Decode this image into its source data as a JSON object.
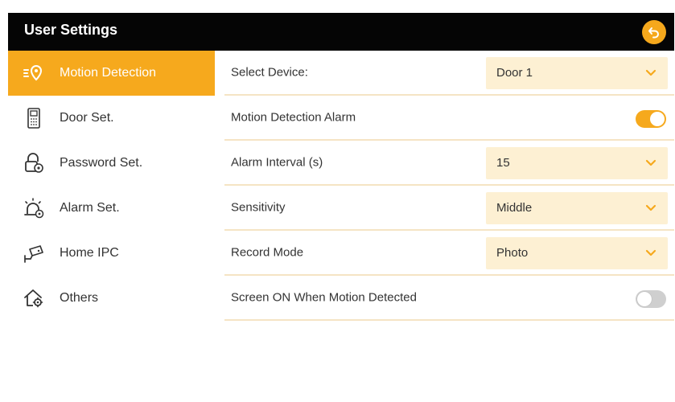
{
  "header": {
    "title": "User Settings",
    "back_icon": "back-arrow-icon",
    "accent": "#f5a81c"
  },
  "sidebar": {
    "items": [
      {
        "label": "Motion Detection",
        "icon": "motion-sensor-icon",
        "active": true
      },
      {
        "label": "Door Set.",
        "icon": "door-station-icon",
        "active": false
      },
      {
        "label": "Password Set.",
        "icon": "lock-icon",
        "active": false
      },
      {
        "label": "Alarm Set.",
        "icon": "alarm-icon",
        "active": false
      },
      {
        "label": "Home IPC",
        "icon": "camera-icon",
        "active": false
      },
      {
        "label": "Others",
        "icon": "home-gear-icon",
        "active": false
      }
    ]
  },
  "settings": {
    "select_device": {
      "label": "Select Device:",
      "value": "Door 1"
    },
    "motion_alarm": {
      "label": "Motion Detection Alarm",
      "enabled": true
    },
    "alarm_interval": {
      "label": "Alarm Interval (s)",
      "value": "15"
    },
    "sensitivity": {
      "label": "Sensitivity",
      "value": "Middle"
    },
    "record_mode": {
      "label": "Record Mode",
      "value": "Photo"
    },
    "screen_on": {
      "label": "Screen ON When Motion Detected",
      "enabled": false
    }
  },
  "colors": {
    "accent": "#f6a91d",
    "select_bg": "#fdf0d3",
    "header_bg": "#050505"
  }
}
